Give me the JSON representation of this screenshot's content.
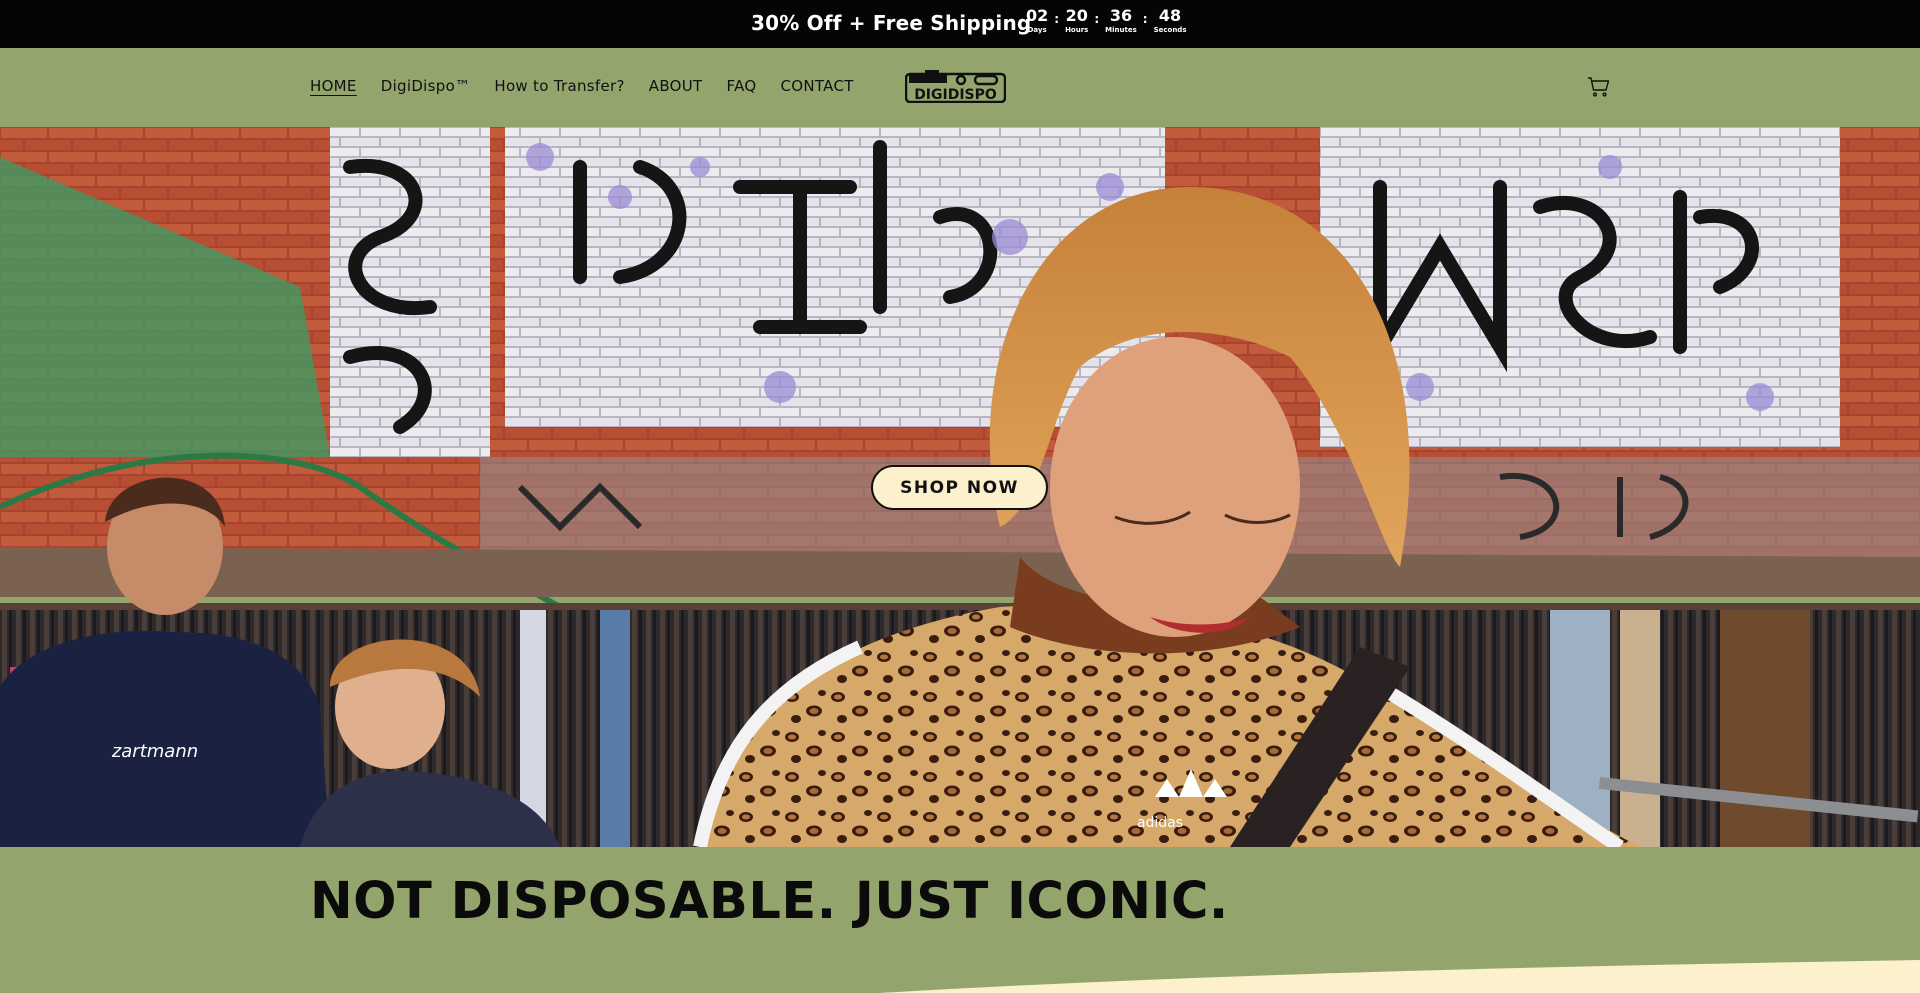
{
  "announcement": {
    "text": "30% Off + Free Shipping",
    "countdown": [
      {
        "value": "02",
        "label": "Days"
      },
      {
        "value": "20",
        "label": "Hours"
      },
      {
        "value": "36",
        "label": "Minutes"
      },
      {
        "value": "48",
        "label": "Seconds"
      }
    ],
    "separator": ":"
  },
  "nav": {
    "items": [
      {
        "label": "HOME",
        "active": true
      },
      {
        "label": "DigiDispo™",
        "active": false
      },
      {
        "label": "How to Transfer?",
        "active": false
      },
      {
        "label": "ABOUT",
        "active": false
      },
      {
        "label": "FAQ",
        "active": false
      },
      {
        "label": "CONTACT",
        "active": false
      }
    ]
  },
  "brand": {
    "logo_text": "DIGIDISPO"
  },
  "header": {
    "cart_icon": "cart-icon"
  },
  "hero": {
    "cta_label": "SHOP NOW"
  },
  "tagline": {
    "text": "NOT DISPOSABLE. JUST ICONIC."
  },
  "colors": {
    "announcement_bg": "#050505",
    "header_bg": "#93a56d",
    "cta_bg": "#fdf0cc",
    "accent_cream": "#fdf0cc"
  }
}
